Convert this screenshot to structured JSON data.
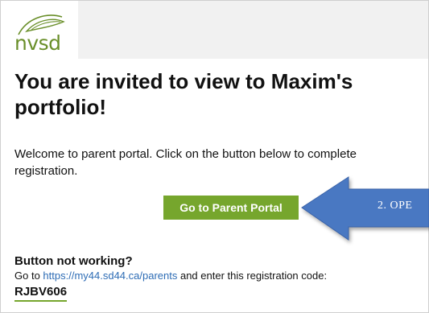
{
  "logo": {
    "text": "nvsd",
    "leaf_color": "#6a8f2a"
  },
  "email": {
    "heading": "You are invited to view to Maxim's portfolio!",
    "welcome_text": "Welcome to parent portal. Click on the button below to complete registration.",
    "button_label": "Go to Parent Portal",
    "button_color": "#76a62d",
    "help_heading": "Button not working?",
    "help_prefix": "Go to ",
    "help_link": "https://my44.sd44.ca/parents",
    "help_suffix": " and enter this registration code:",
    "registration_code": "RJBV606"
  },
  "callout": {
    "text": "2. OPE",
    "arrow_color": "#4a78c2",
    "icon": "left-arrow-callout"
  }
}
